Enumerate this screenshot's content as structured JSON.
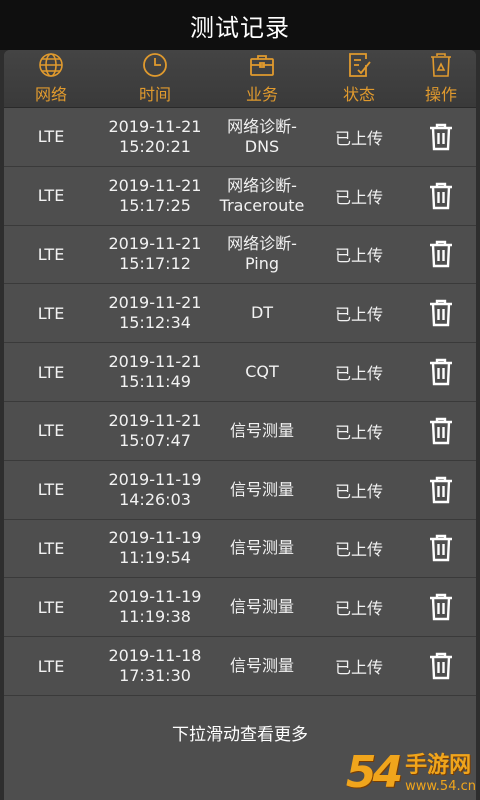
{
  "title": "测试记录",
  "headers": {
    "network": "网络",
    "time": "时间",
    "business": "业务",
    "status": "状态",
    "action": "操作"
  },
  "rows": [
    {
      "network": "LTE",
      "date": "2019-11-21",
      "time": "15:20:21",
      "biz1": "网络诊断-",
      "biz2": "DNS",
      "status": "已上传"
    },
    {
      "network": "LTE",
      "date": "2019-11-21",
      "time": "15:17:25",
      "biz1": "网络诊断-",
      "biz2": "Traceroute",
      "status": "已上传"
    },
    {
      "network": "LTE",
      "date": "2019-11-21",
      "time": "15:17:12",
      "biz1": "网络诊断-",
      "biz2": "Ping",
      "status": "已上传"
    },
    {
      "network": "LTE",
      "date": "2019-11-21",
      "time": "15:12:34",
      "biz1": "DT",
      "biz2": "",
      "status": "已上传"
    },
    {
      "network": "LTE",
      "date": "2019-11-21",
      "time": "15:11:49",
      "biz1": "CQT",
      "biz2": "",
      "status": "已上传"
    },
    {
      "network": "LTE",
      "date": "2019-11-21",
      "time": "15:07:47",
      "biz1": "信号测量",
      "biz2": "",
      "status": "已上传"
    },
    {
      "network": "LTE",
      "date": "2019-11-19",
      "time": "14:26:03",
      "biz1": "信号测量",
      "biz2": "",
      "status": "已上传"
    },
    {
      "network": "LTE",
      "date": "2019-11-19",
      "time": "11:19:54",
      "biz1": "信号测量",
      "biz2": "",
      "status": "已上传"
    },
    {
      "network": "LTE",
      "date": "2019-11-19",
      "time": "11:19:38",
      "biz1": "信号测量",
      "biz2": "",
      "status": "已上传"
    },
    {
      "network": "LTE",
      "date": "2019-11-18",
      "time": "17:31:30",
      "biz1": "信号测量",
      "biz2": "",
      "status": "已上传"
    }
  ],
  "footer_hint": "下拉滑动查看更多",
  "watermark": {
    "number": "54",
    "label": "手游网",
    "url": "www.54.cn"
  },
  "colors": {
    "accent": "#e09a2e",
    "title_bar": "#0f0f0f",
    "panel": "#4e4e4e"
  },
  "icons": {
    "network": "globe-icon",
    "time": "clock-icon",
    "business": "briefcase-icon",
    "status": "checklist-icon",
    "action": "recycle-bin-icon",
    "row_action": "trash-icon"
  }
}
